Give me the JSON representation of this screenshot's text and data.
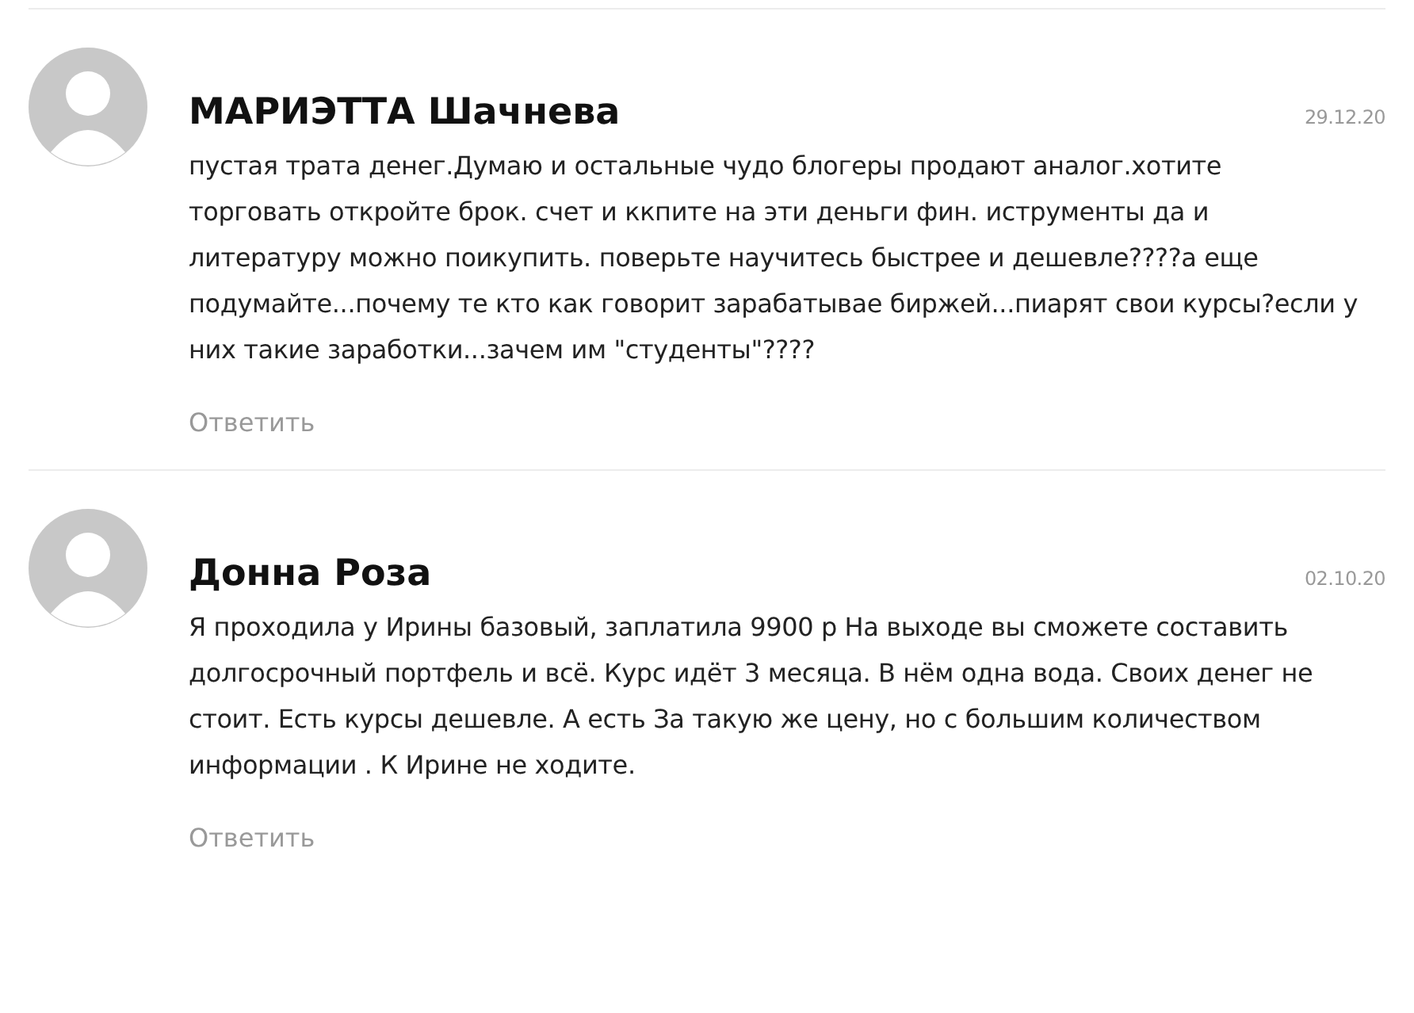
{
  "comments": [
    {
      "author": "МАРИЭТТА Шачнева",
      "date": "29.12.20",
      "text": "пустая трата денег.Думаю и остальные чудо блогеры продают аналог.хотите торговать откройте брок. счет и ккпите на эти деньги фин. иструменты да и литературу можно поикупить. поверьте научитесь быстрее и дешевле????а еще подумайте...почему те кто как говорит зарабатывае биржей...пиарят свои курсы?если у них такие заработки...зачем им \"студенты\"????",
      "reply": "Ответить"
    },
    {
      "author": "Донна Роза",
      "date": "02.10.20",
      "text": "Я проходила у Ирины базовый, заплатила 9900 р На выходе вы сможете составить долгосрочный портфель и всё. Курс идёт 3 месяца. В нём одна вода. Своих денег не стоит. Есть курсы дешевле. А есть За такую же цену, но с большим количеством информации . К Ирине не ходите.",
      "reply": "Ответить"
    }
  ]
}
